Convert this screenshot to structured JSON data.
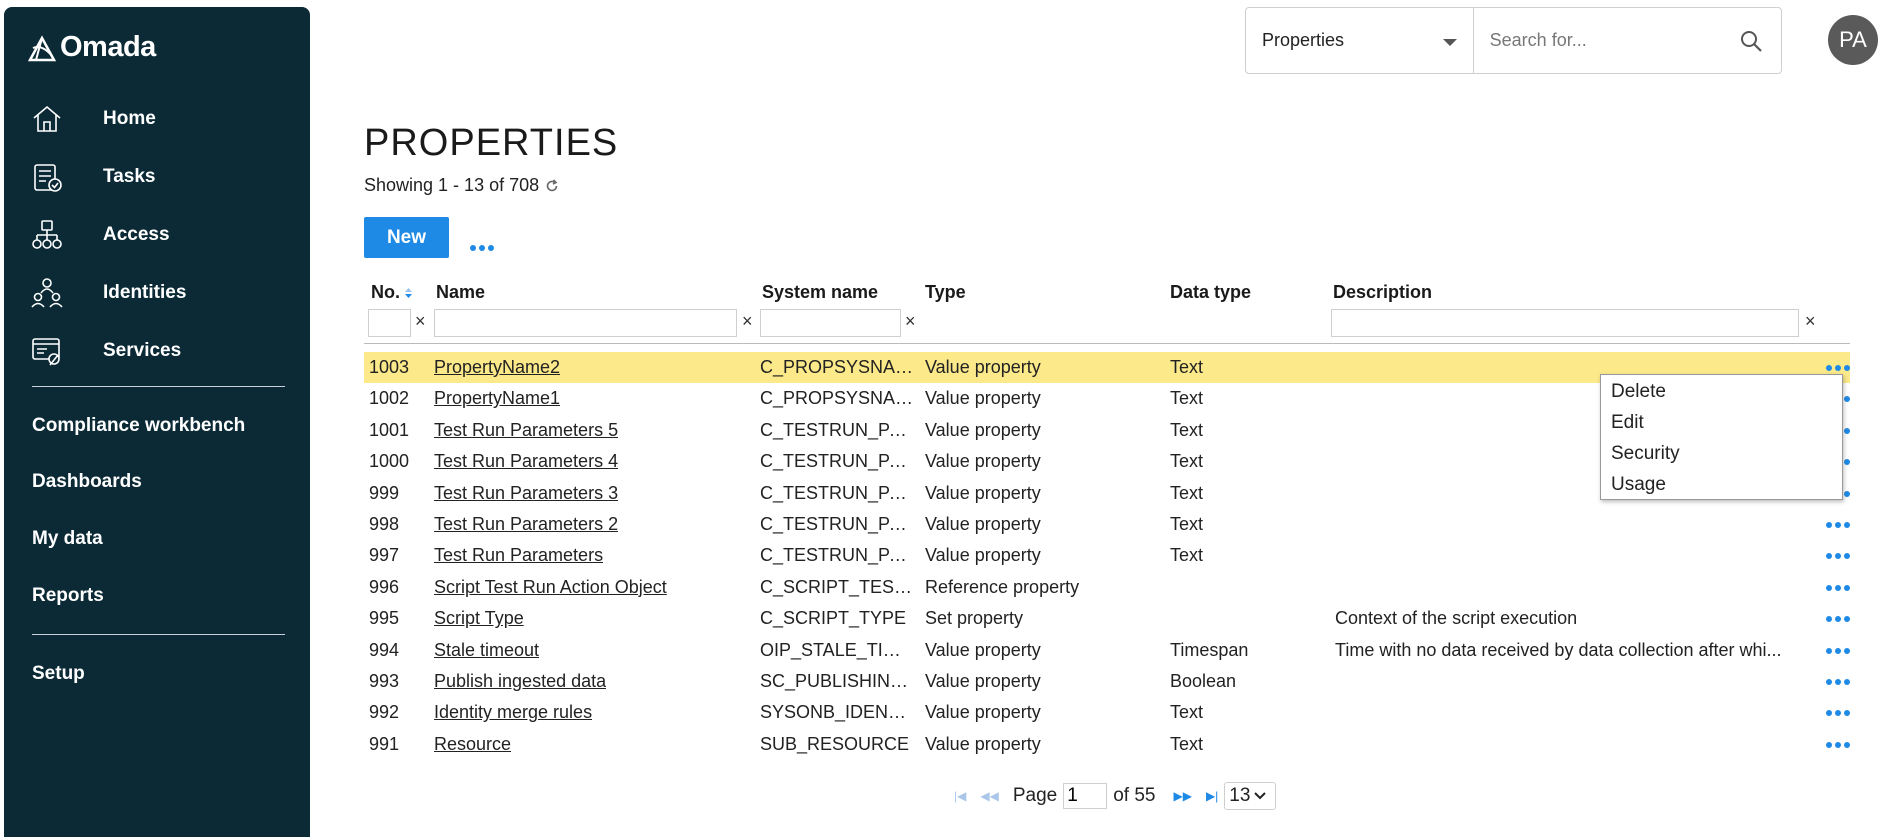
{
  "app": {
    "logo_text": "Omada",
    "brand_color": "#0b2a36",
    "accent_color": "#1f8ae6",
    "highlight_color": "#fbe98a"
  },
  "sidebar": {
    "nav": [
      {
        "label": "Home",
        "icon": "home-icon"
      },
      {
        "label": "Tasks",
        "icon": "tasks-icon"
      },
      {
        "label": "Access",
        "icon": "access-icon"
      },
      {
        "label": "Identities",
        "icon": "identities-icon"
      },
      {
        "label": "Services",
        "icon": "services-icon"
      }
    ],
    "links": [
      "Compliance workbench",
      "Dashboards",
      "My data",
      "Reports"
    ],
    "setup": "Setup"
  },
  "topbar": {
    "search_scope": "Properties",
    "search_placeholder": "Search for...",
    "avatar_initials": "PA"
  },
  "main": {
    "title": "PROPERTIES",
    "showing": "Showing 1 - 13 of 708",
    "new_label": "New",
    "columns": [
      "No.",
      "Name",
      "System name",
      "Type",
      "Data type",
      "Description"
    ],
    "clear_glyph": "×",
    "rows": [
      {
        "no": "1003",
        "name": "PropertyName2",
        "system": "C_PROPSYSNAM...",
        "type": "Value property",
        "datatype": "Text",
        "desc": ""
      },
      {
        "no": "1002",
        "name": "PropertyName1",
        "system": "C_PROPSYSNAM...",
        "type": "Value property",
        "datatype": "Text",
        "desc": ""
      },
      {
        "no": "1001",
        "name": "Test Run Parameters 5",
        "system": "C_TESTRUN_PAR...",
        "type": "Value property",
        "datatype": "Text",
        "desc": ""
      },
      {
        "no": "1000",
        "name": "Test Run Parameters 4",
        "system": "C_TESTRUN_PAR...",
        "type": "Value property",
        "datatype": "Text",
        "desc": ""
      },
      {
        "no": "999",
        "name": "Test Run Parameters 3",
        "system": "C_TESTRUN_PAR...",
        "type": "Value property",
        "datatype": "Text",
        "desc": ""
      },
      {
        "no": "998",
        "name": "Test Run Parameters 2",
        "system": "C_TESTRUN_PAR...",
        "type": "Value property",
        "datatype": "Text",
        "desc": ""
      },
      {
        "no": "997",
        "name": "Test Run Parameters",
        "system": "C_TESTRUN_PAR...",
        "type": "Value property",
        "datatype": "Text",
        "desc": ""
      },
      {
        "no": "996",
        "name": "Script Test Run Action Object",
        "system": "C_SCRIPT_TESTR...",
        "type": "Reference property",
        "datatype": "",
        "desc": ""
      },
      {
        "no": "995",
        "name": "Script Type",
        "system": "C_SCRIPT_TYPE",
        "type": "Set property",
        "datatype": "",
        "desc": "Context of the script execution"
      },
      {
        "no": "994",
        "name": "Stale timeout",
        "system": "OIP_STALE_TIME...",
        "type": "Value property",
        "datatype": "Timespan",
        "desc": "Time with no data received by data collection after whi..."
      },
      {
        "no": "993",
        "name": "Publish ingested data",
        "system": "SC_PUBLISHING...",
        "type": "Value property",
        "datatype": "Boolean",
        "desc": ""
      },
      {
        "no": "992",
        "name": "Identity merge rules",
        "system": "SYSONB_IDENTI...",
        "type": "Value property",
        "datatype": "Text",
        "desc": ""
      },
      {
        "no": "991",
        "name": "Resource",
        "system": "SUB_RESOURCE",
        "type": "Value property",
        "datatype": "Text",
        "desc": ""
      }
    ],
    "context_menu": [
      "Delete",
      "Edit",
      "Security",
      "Usage"
    ]
  },
  "pager": {
    "page_label": "Page",
    "page_value": "1",
    "of_label": "of 55",
    "page_size": "13"
  }
}
